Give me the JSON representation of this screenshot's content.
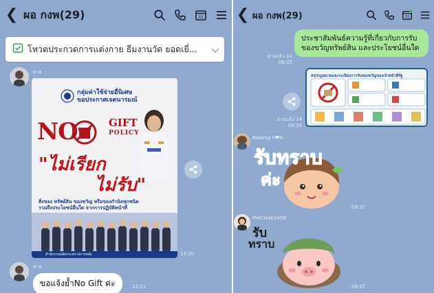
{
  "colors": {
    "chat_bg": "#8fa9cf",
    "bubble_white": "#ffffff",
    "bubble_green": "#a9e89a",
    "poster_red": "#c3121a",
    "poster_blue": "#1c3a8c"
  },
  "left": {
    "header": {
      "back_icon": "chevron-left-icon",
      "title": "ผอ กงพ(29)",
      "icons": [
        "search-icon",
        "phone-icon",
        "calendar-icon",
        "menu-icon"
      ],
      "calendar_number": "31"
    },
    "pinned": {
      "icon": "poll-icon",
      "text": "โหวตประกวดการแต่งกาย ธีมงานวัด ยอดเยี่...",
      "chevron": "chevron-down-icon"
    },
    "messages": [
      {
        "sender": "ต่าย",
        "type": "image",
        "time": "13:20",
        "poster": {
          "org_line1": "กลุ่มค่าใช้จ่ายอื่นิเศษ",
          "org_line2": "ขอประกาศเจตนารมณ์",
          "no": "NO",
          "gift": "GIFT",
          "policy": "POLICY",
          "slogan1": "\"ไม่เรียก",
          "slogan2": "ไม่รับ\"",
          "sub_line1": "สิ่งของ ทรัพย์สิน ของขวัญ หรือของกำนัลทุกชนิด",
          "sub_line2": "รวมถึงประโยชน์อื่นใด จากการปฏิบัติหน้าที่",
          "footer": "สำนักงานปลัดกระทรวงการคลัง"
        }
      },
      {
        "sender": "ต่าย",
        "type": "text",
        "text": "ขอแจ้งย้ำNo Gift ค่ะ",
        "time": "13:21"
      }
    ]
  },
  "right": {
    "header": {
      "back_icon": "chevron-left-icon",
      "title": "ผอ กงพ(29)",
      "icons": [
        "search-icon",
        "phone-icon",
        "calendar-icon",
        "menu-icon"
      ],
      "calendar_number": "31"
    },
    "messages": [
      {
        "type": "text",
        "own": true,
        "text": "ประชาสัมพันธ์ความรู้ที่เกี่ยวกับการรับของขวัญทรัพย์สิน และประโยชน์อื่นใด",
        "read": "อ่านแล้ว 14",
        "time": "09:35"
      },
      {
        "type": "image",
        "own": true,
        "card_title": "สรุปกฎหมายและระเบียบการรับของขวัญของเจ้าหน้าที่รัฐ",
        "read": "อ่านแล้ว 14",
        "time": "09:35"
      },
      {
        "type": "sticker",
        "sender": "Raeeng F♥N",
        "sticker_text_1": "รับทราบ",
        "sticker_text_2": "ค่ะ",
        "time": "09:37"
      },
      {
        "type": "sticker",
        "sender": "PHICHAK3458",
        "sticker_text_1": "รับ",
        "sticker_text_2": "ทราบ",
        "time": "09:37"
      }
    ]
  }
}
